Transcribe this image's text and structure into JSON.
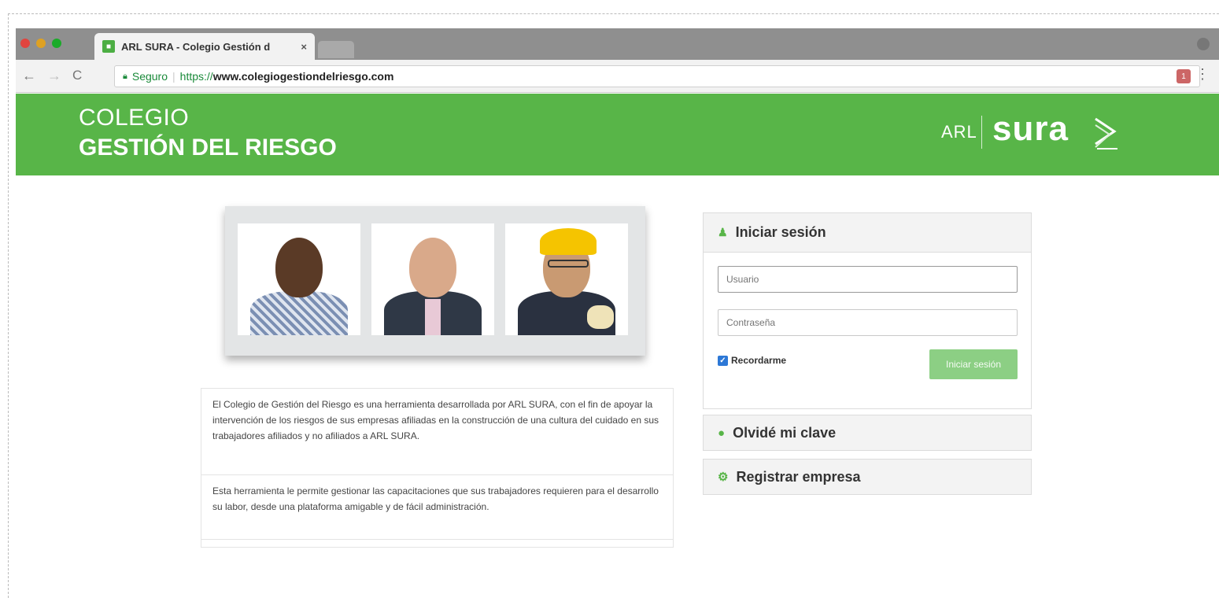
{
  "browser": {
    "tab_title": "ARL SURA - Colegio Gestión d",
    "tab_close": "×",
    "secure_label": "Seguro",
    "url_scheme": "https://",
    "url_rest": "www.colegiogestiondelriesgo.com",
    "extension_badge": "1",
    "traffic_colors": [
      "#e0443e",
      "#dea123",
      "#1aab29"
    ]
  },
  "header": {
    "title_line1": "COLEGIO",
    "title_line2": "GESTIÓN DEL RIESGO",
    "logo_prefix": "ARL",
    "logo_name": "sura",
    "brand_color": "#58b548"
  },
  "description": {
    "paragraph1": "El Colegio de Gestión del Riesgo es una herramienta desarrollada por ARL SURA, con el fin de apoyar la intervención de los riesgos de sus empresas afiliadas en la construcción de una cultura del cuidado en sus trabajadores afiliados y no afiliados a ARL SURA.",
    "paragraph2": "Esta herramienta le permite gestionar las capacitaciones que sus trabajadores requieren para el desarrollo su labor, desde una plataforma amigable y de fácil administración."
  },
  "login": {
    "title": "Iniciar sesión",
    "username_placeholder": "Usuario",
    "password_placeholder": "Contraseña",
    "remember_label": "Recordarme",
    "remember_checked": true,
    "submit_label": "Iniciar sesión"
  },
  "panels": {
    "forgot_label": "Olvidé mi clave",
    "register_label": "Registrar empresa"
  },
  "icons": [
    "user-icon",
    "info-circle-icon",
    "cogs-icon",
    "lock-icon",
    "star-icon",
    "reload-icon"
  ]
}
